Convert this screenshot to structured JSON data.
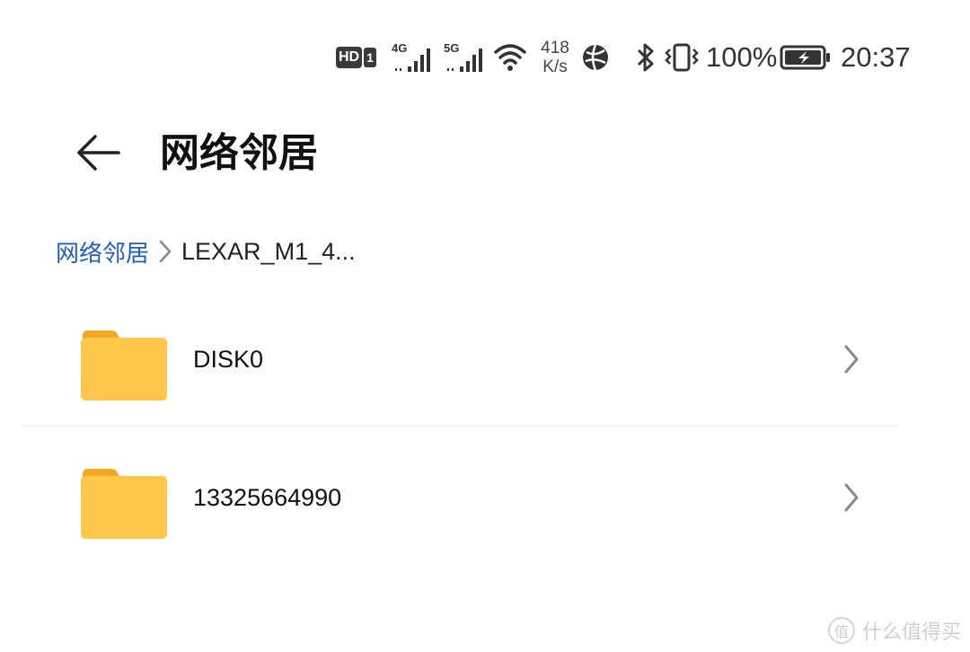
{
  "status_bar": {
    "hd_label": "HD",
    "sim_slot": "1",
    "network_1": "4G",
    "network_2": "5G",
    "speed_value": "418",
    "speed_unit": "K/s",
    "battery": "100%",
    "time": "20:37",
    "icons": [
      "hd-icon",
      "signal-4g-icon",
      "signal-5g-icon",
      "wifi-icon",
      "speed-indicator",
      "globe-icon",
      "bluetooth-icon",
      "vibrate-icon",
      "battery-charging-icon"
    ]
  },
  "header": {
    "back_icon": "arrow-left-icon",
    "title": "网络邻居"
  },
  "breadcrumb": {
    "root": "网络邻居",
    "current": "LEXAR_M1_4..."
  },
  "items": [
    {
      "name": "DISK0",
      "icon": "folder-icon"
    },
    {
      "name": "13325664990",
      "icon": "folder-icon"
    }
  ],
  "watermark": {
    "badge": "值",
    "text": "什么值得买"
  },
  "colors": {
    "accent": "#1c5fbf",
    "folder": "#ffc84a",
    "folder_tab": "#f5a623"
  }
}
